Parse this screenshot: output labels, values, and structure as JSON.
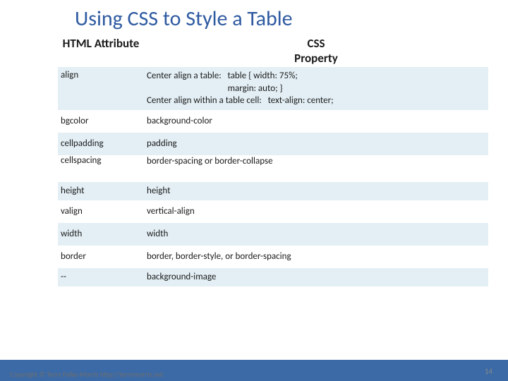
{
  "title": "Using CSS to Style a Table",
  "table": {
    "header": {
      "left": "HTML Attribute",
      "right": "CSS\nProperty"
    },
    "rows": [
      {
        "attr": "align",
        "css": "Center align a table:   table { width: 75%; \n                                       margin: auto; }\nCenter align within a table cell:   text-align: center;"
      },
      {
        "attr": "bgcolor",
        "css": "background-color"
      },
      {
        "attr": "cellpadding",
        "css": "padding"
      },
      {
        "attr": "cellspacing",
        "css": "\nborder-spacing or border-collapse"
      },
      {
        "attr": "height",
        "css": "height"
      },
      {
        "attr": "valign",
        "css": "vertical-align"
      },
      {
        "attr": "width",
        "css": "width"
      },
      {
        "attr": "border",
        "css": "border, border-style, or border-spacing"
      },
      {
        "attr": "--",
        "css": "background-image"
      }
    ]
  },
  "footer": {
    "copyright": "Copyright © Terry Felke-Morris http://terrymorris.net",
    "page": "14"
  }
}
